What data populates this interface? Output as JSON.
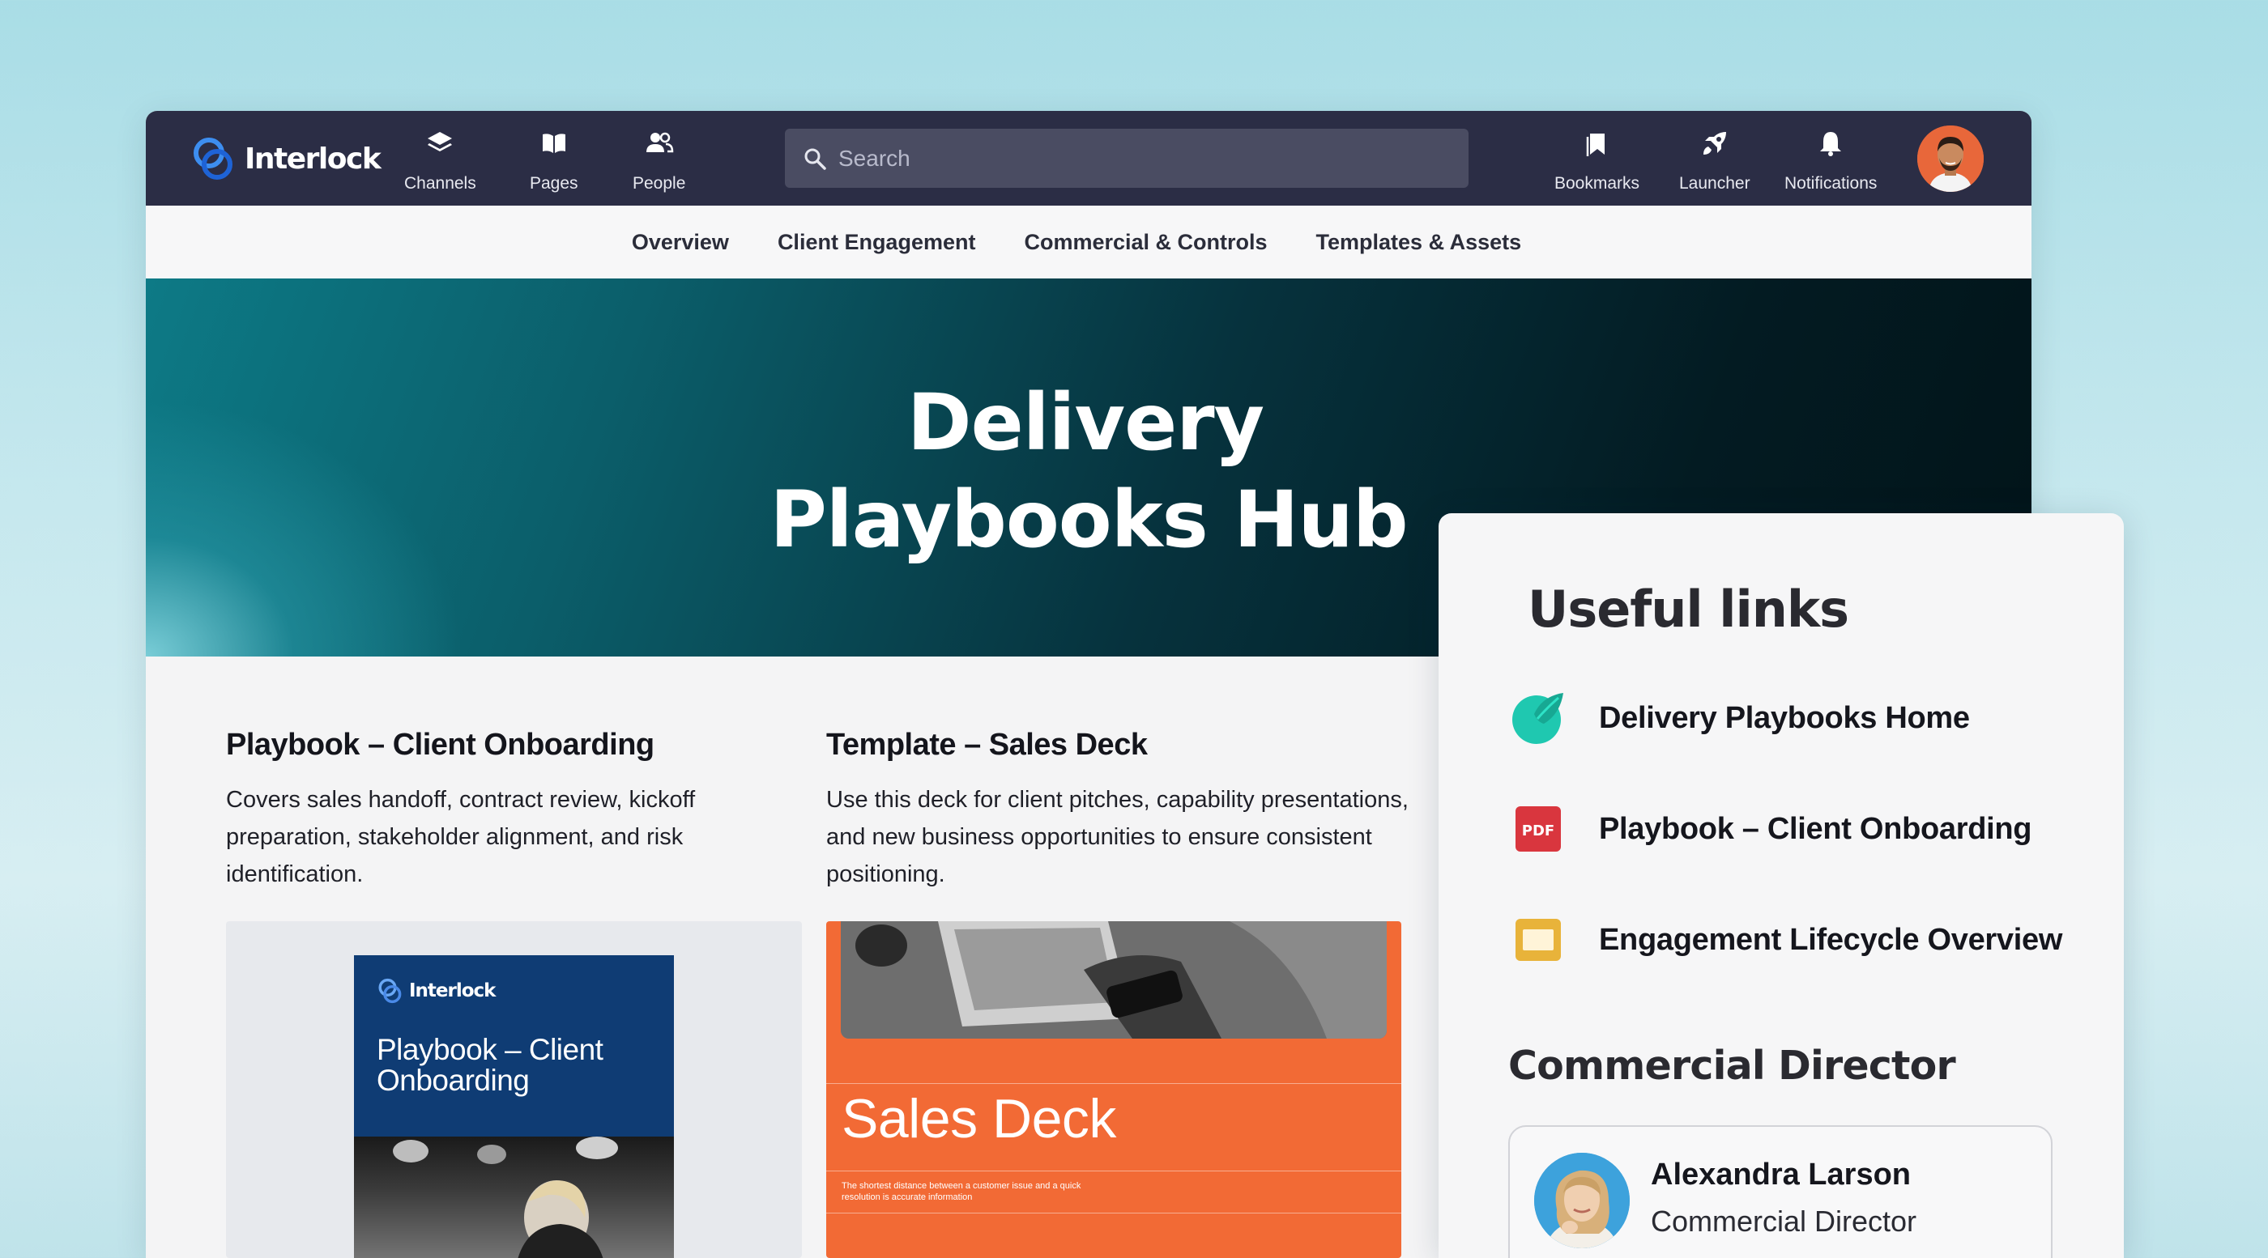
{
  "app": {
    "name": "Interlock"
  },
  "topbar": {
    "nav": [
      {
        "label": "Channels",
        "icon": "layers-icon"
      },
      {
        "label": "Pages",
        "icon": "book-icon"
      },
      {
        "label": "People",
        "icon": "people-icon"
      }
    ],
    "search": {
      "placeholder": "Search",
      "value": ""
    },
    "actions": [
      {
        "label": "Bookmarks",
        "icon": "bookmarks-icon"
      },
      {
        "label": "Launcher",
        "icon": "rocket-icon"
      },
      {
        "label": "Notifications",
        "icon": "bell-icon"
      }
    ]
  },
  "subnav": {
    "items": [
      "Overview",
      "Client Engagement",
      "Commercial & Controls",
      "Templates & Assets"
    ]
  },
  "hero": {
    "line1": "Delivery",
    "line2": "Playbooks Hub",
    "colors": {
      "start": "#0d7a86",
      "end": "#021419"
    }
  },
  "cards": [
    {
      "title": "Playbook – Client Onboarding",
      "description": "Covers sales handoff, contract review, kickoff preparation, stakeholder alignment, and risk identification.",
      "thumbnail": {
        "logo_text": "Interlock",
        "cover_title": "Playbook – Client Onboarding",
        "color": "#0f3c74"
      }
    },
    {
      "title": "Template – Sales Deck",
      "description": "Use this deck for client pitches, capability presentations, and new business opportunities to ensure consistent positioning.",
      "thumbnail": {
        "deck_title": "Sales Deck",
        "deck_subtitle": "The shortest distance between a customer issue and a quick resolution is accurate information",
        "color": "#f26a35"
      }
    }
  ],
  "useful_links": {
    "heading": "Useful links",
    "links": [
      {
        "label": "Delivery Playbooks Home",
        "icon": "leaf-icon"
      },
      {
        "label": "Playbook – Client Onboarding",
        "icon": "pdf-icon",
        "icon_text": "PDF"
      },
      {
        "label": "Engagement Lifecycle Overview",
        "icon": "slides-icon"
      }
    ]
  },
  "contact": {
    "heading": "Commercial Director",
    "name": "Alexandra Larson",
    "role": "Commercial Director"
  },
  "colors": {
    "topbar": "#2b2d45",
    "accent_blue": "#2f7de1",
    "pdf_red": "#d9363e",
    "slides_yellow": "#e8b33a",
    "leaf_teal": "#1fc8b0"
  }
}
